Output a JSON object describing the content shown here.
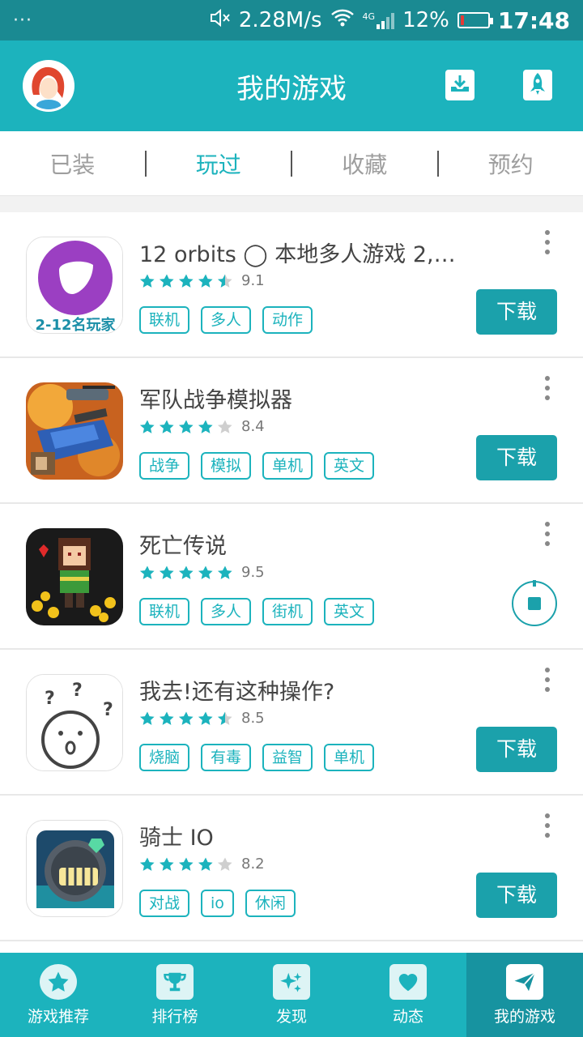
{
  "status_bar": {
    "menu_dots": "···",
    "speed": "2.28M/s",
    "network": "4G",
    "battery_percent": "12%",
    "battery_level": 0.12,
    "time": "17:48"
  },
  "app_bar": {
    "title": "我的游戏",
    "download_icon": "download-tray-icon",
    "rocket_icon": "rocket-icon"
  },
  "tabs": [
    {
      "label": "已装",
      "active": false
    },
    {
      "label": "玩过",
      "active": true
    },
    {
      "label": "收藏",
      "active": false
    },
    {
      "label": "预约",
      "active": false
    }
  ],
  "games": [
    {
      "name": "12 orbits ◯ 本地多人游戏 2,…",
      "rating": "9.1",
      "rating_value": 4.5,
      "tags": [
        "联机",
        "多人",
        "动作"
      ],
      "action": "下载",
      "icon_text": "2-12名玩家"
    },
    {
      "name": "军队战争模拟器",
      "rating": "8.4",
      "rating_value": 4.0,
      "tags": [
        "战争",
        "模拟",
        "单机",
        "英文"
      ],
      "action": "下载"
    },
    {
      "name": "死亡传说",
      "rating": "9.5",
      "rating_value": 5.0,
      "tags": [
        "联机",
        "多人",
        "街机",
        "英文"
      ],
      "action": "stop"
    },
    {
      "name": "我去!还有这种操作?",
      "rating": "8.5",
      "rating_value": 4.5,
      "tags": [
        "烧脑",
        "有毒",
        "益智",
        "单机"
      ],
      "action": "下载"
    },
    {
      "name": "骑士 IO",
      "rating": "8.2",
      "rating_value": 4.0,
      "tags": [
        "对战",
        "io",
        "休闲"
      ],
      "action": "下载"
    }
  ],
  "bottom_nav": [
    {
      "label": "游戏推荐",
      "icon": "star-icon",
      "active": false
    },
    {
      "label": "排行榜",
      "icon": "trophy-icon",
      "active": false
    },
    {
      "label": "发现",
      "icon": "sparkle-icon",
      "active": false
    },
    {
      "label": "动态",
      "icon": "heart-icon",
      "active": false
    },
    {
      "label": "我的游戏",
      "icon": "paper-plane-icon",
      "active": true
    }
  ],
  "colors": {
    "status_bar": "#1a8a92",
    "accent": "#1cb3bd",
    "button": "#1ba1ab",
    "star_on": "#1cb3bd",
    "star_off": "#cfcfcf"
  }
}
